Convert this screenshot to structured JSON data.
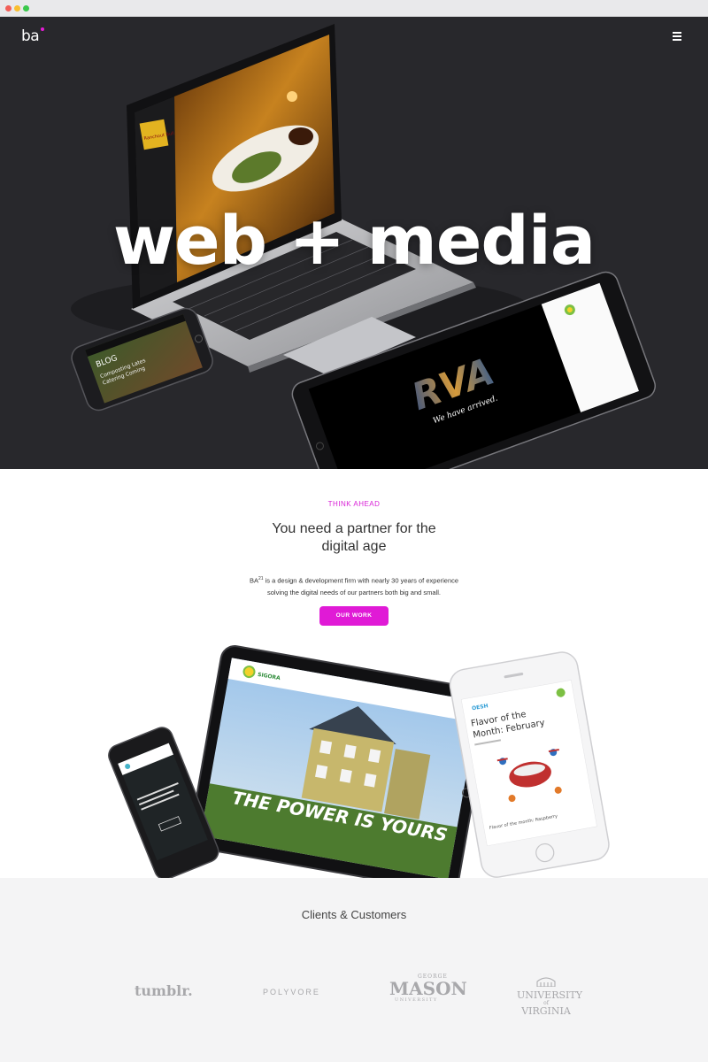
{
  "hero": {
    "logo": "ba",
    "headline": "web + media",
    "laptop_screen": {
      "brand": "Ranchout Bull"
    },
    "phone_screen": {
      "title": "BLOG",
      "caption": "Composting Lates Catering Coming"
    },
    "tablet_screen": {
      "big_text": "RVA",
      "tagline": "We have arrived."
    }
  },
  "intro": {
    "eyebrow": "THINK AHEAD",
    "title_line1": "You need a partner for the",
    "title_line2": "digital age",
    "body_brand": "BA",
    "body_sup": "21",
    "body_rest": " is a design & development firm with nearly 30 years of experience",
    "body_line2": "solving the digital needs of our partners both big and small.",
    "cta_label": "OUR WORK",
    "tablet_overlay": "THE POWER IS YOURS",
    "phone_right_title": "Flavor of the Month: February",
    "phone_right_footer": "Flavor of the month: Raspberry",
    "phone_right_brand": "OESH"
  },
  "clients": {
    "title": "Clients & Customers",
    "logos": {
      "tumblr": "tumblr.",
      "polyvore": "POLYVORE",
      "gmu_top": "GEORGE",
      "gmu_main": "MASON",
      "gmu_bottom": "UNIVERSITY",
      "uva_main": "UNIVERSITY",
      "uva_of": "of",
      "uva_state": "VIRGINIA"
    }
  },
  "colors": {
    "accent": "#e01ad6",
    "hero_bg": "#28282c",
    "light_bg": "#f4f4f5"
  }
}
